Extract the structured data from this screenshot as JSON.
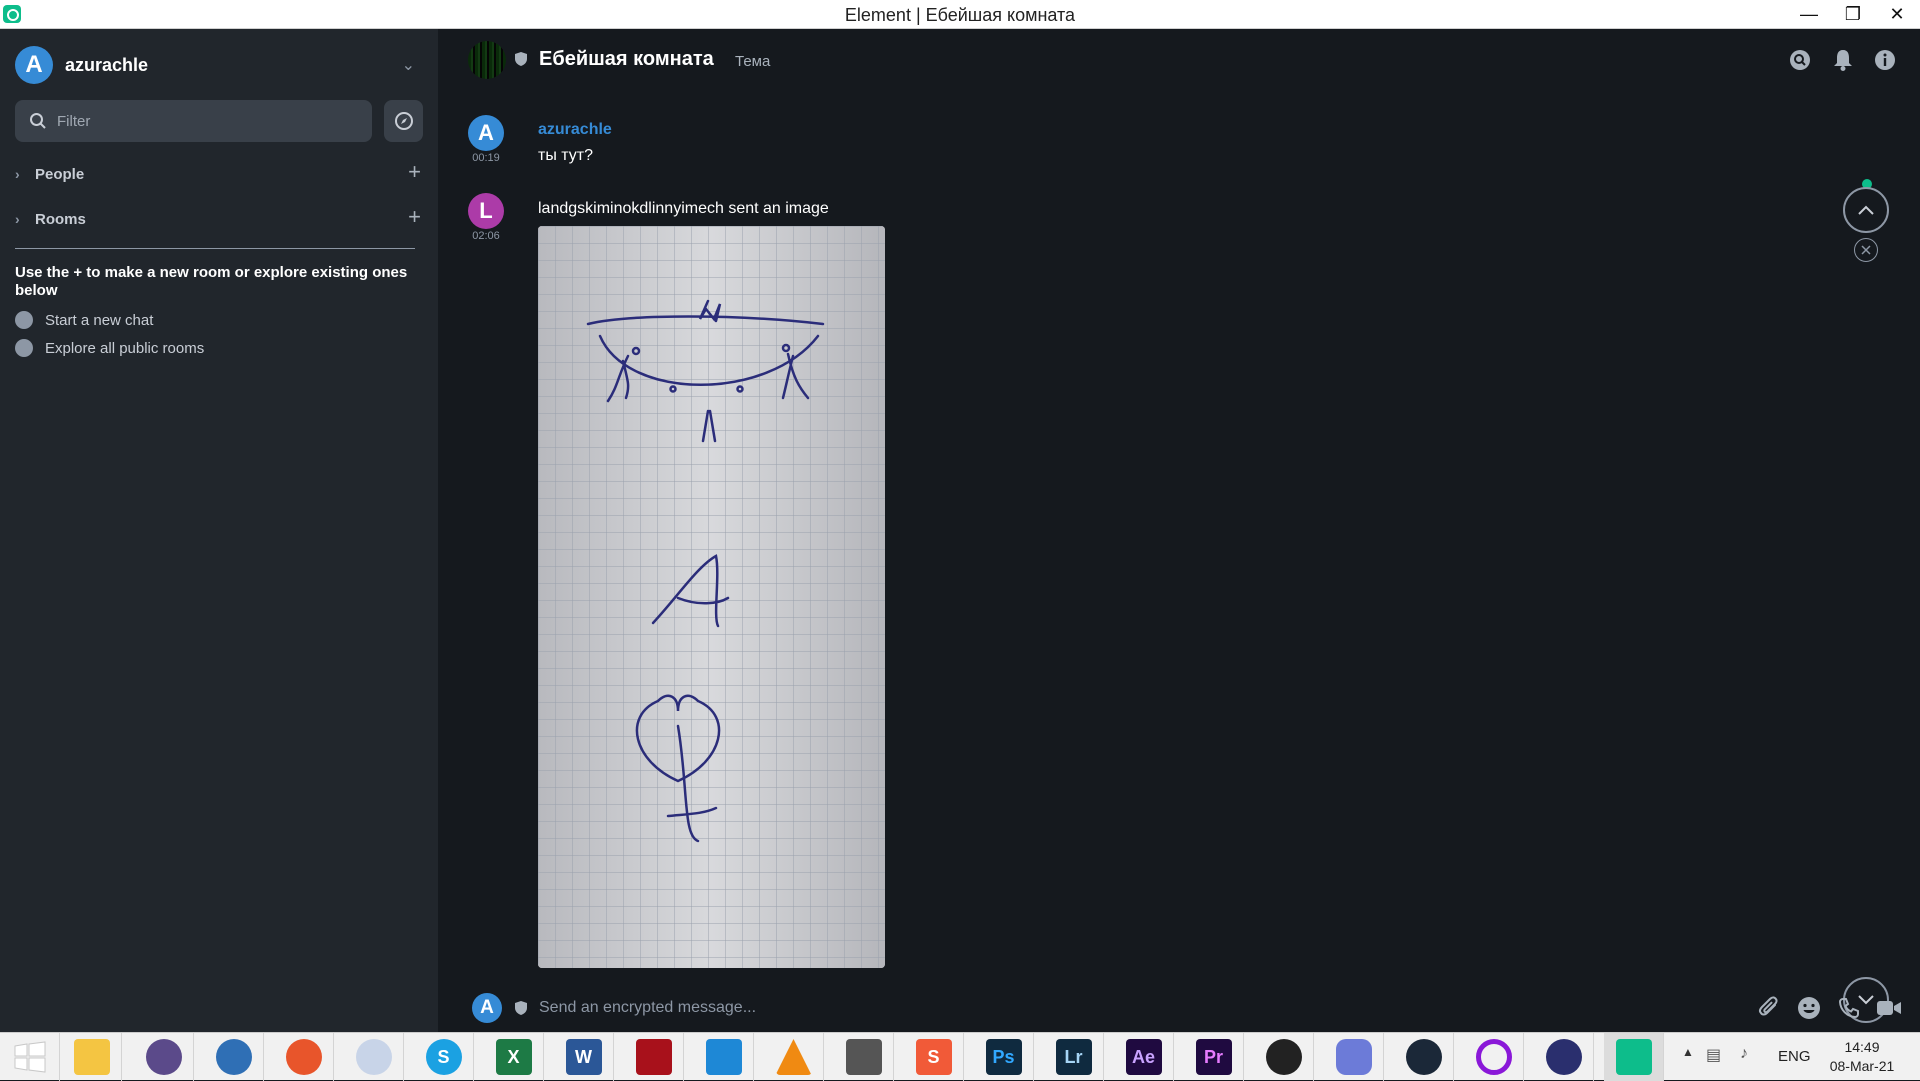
{
  "window": {
    "title": "Element | Ебейшая комната",
    "minimize_icon": "—",
    "maximize_icon": "❐",
    "close_icon": "✕"
  },
  "sidebar": {
    "user": {
      "avatar_letter": "A",
      "name": "azurachle",
      "avatar_color": "#368bd6"
    },
    "filter": {
      "placeholder": "Filter"
    },
    "sections": [
      {
        "label": "People"
      },
      {
        "label": "Rooms"
      }
    ],
    "hint": "Use the + to make a new room or explore existing ones below",
    "actions": [
      {
        "label": "Start a new chat",
        "icon": "chat-bubble-icon"
      },
      {
        "label": "Explore all public rooms",
        "icon": "compass-icon"
      }
    ]
  },
  "room": {
    "name": "Ебейшая комната",
    "topic": "Тема",
    "header_icons": [
      "search-icon",
      "bell-icon",
      "info-icon"
    ],
    "composer_placeholder": "Send an encrypted message...",
    "composer_avatar_letter": "A",
    "composer_icons": [
      "paperclip-icon",
      "emoji-icon",
      "phone-icon",
      "video-camera-icon"
    ]
  },
  "timeline": [
    {
      "sender": "azurachle",
      "avatar_letter": "A",
      "avatar_color": "#368bd6",
      "time": "00:19",
      "body": "ты тут?"
    },
    {
      "sender": "landgskiminokdlinnyimech",
      "avatar_letter": "L",
      "avatar_color": "#ac3ba8",
      "time": "02:06",
      "body": "landgskiminokdlinnyimech sent an image",
      "attachment": "image"
    }
  ],
  "accent": "#0dbd8b",
  "taskbar": {
    "apps": [
      "windows-start-icon",
      "file-explorer-icon",
      "qbittorrent-icon",
      "cyberduck-icon",
      "firefox-icon",
      "moon-icon",
      "skype-icon",
      "excel-icon",
      "word-icon",
      "acrobat-icon",
      "vscode-icon",
      "vlc-icon",
      "downloader-icon",
      "sublime-icon",
      "photoshop-icon",
      "lightroom-icon",
      "after-effects-icon",
      "premiere-icon",
      "obs-icon",
      "discord-icon",
      "steam-icon",
      "circle-app-icon",
      "vpn-lock-icon",
      "element-icon"
    ],
    "tile_labels": {
      "skype": "S",
      "excel": "X",
      "word": "W",
      "sublime": "S",
      "photoshop": "Ps",
      "lightroom": "Lr",
      "after_effects": "Ae",
      "premiere": "Pr"
    },
    "language": "ENG",
    "time": "14:49",
    "date": "08-Mar-21"
  }
}
